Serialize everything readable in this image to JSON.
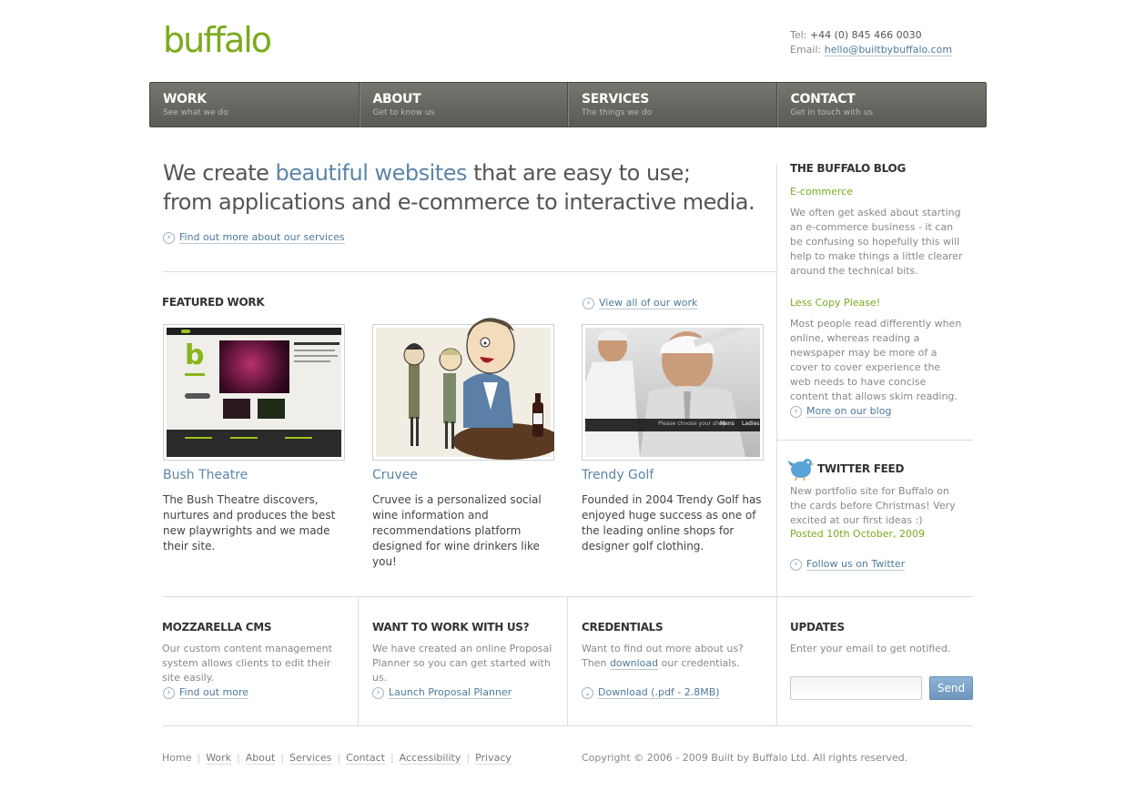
{
  "header": {
    "logo": "buffalo",
    "tel_label": "Tel:",
    "tel_value": "+44 (0) 845 466 0030",
    "email_label": "Email:",
    "email_value": "hello@builtbybuffalo.com"
  },
  "nav": [
    {
      "title": "WORK",
      "sub": "See what we do"
    },
    {
      "title": "ABOUT",
      "sub": "Get to know us"
    },
    {
      "title": "SERVICES",
      "sub": "The things we do"
    },
    {
      "title": "CONTACT",
      "sub": "Get in touch with us"
    }
  ],
  "hero": {
    "line1_pre": "We create ",
    "line1_highlight": "beautiful websites",
    "line1_post": " that are easy to use;",
    "line2": "from applications and e-commerce to interactive media.",
    "link": "Find out more about our services"
  },
  "featured": {
    "title": "FEATURED WORK",
    "view_all": "View all of our work",
    "projects": [
      {
        "title": "Bush Theatre",
        "desc": "The Bush Theatre discovers, nurtures and produces the best new playwrights and we made their site."
      },
      {
        "title": "Cruvee",
        "desc": "Cruvee is a personalized social wine information and recommendations platform designed for wine drinkers like you!"
      },
      {
        "title": "Trendy Golf",
        "desc": "Founded in 2004 Trendy Golf has enjoyed huge success as one of the leading online shops for designer golf clothing."
      }
    ],
    "thumb_text": {
      "bush_logo": "b",
      "golf_bar": "Please choose your shop",
      "golf_mens": "Mens",
      "golf_ladies": "Ladies"
    }
  },
  "blog": {
    "title": "THE BUFFALO BLOG",
    "posts": [
      {
        "title": "E-commerce",
        "text": "We often get asked about starting an e-commerce business - it can be confusing so hopefully this will help to make things a little clearer around the technical bits."
      },
      {
        "title": "Less Copy Please!",
        "text": "Most people read differently when online, whereas reading a newspaper may be more of a cover to cover experience the web needs to have concise content that allows skim reading."
      }
    ],
    "more": "More on our blog"
  },
  "twitter": {
    "title": "TWITTER FEED",
    "text": "New portfolio site for Buffalo on the cards before Christmas! Very excited at our first ideas :)",
    "posted": "Posted 10th October, 2009",
    "follow": "Follow us on Twitter"
  },
  "bottom": {
    "cms": {
      "title": "MOZZARELLA CMS",
      "text": "Our custom content management system allows clients to edit their site easily.",
      "link": "Find out more"
    },
    "work": {
      "title": "WANT TO WORK WITH US?",
      "text": "We have created an online Proposal Planner so you can get started with us.",
      "link": "Launch Proposal Planner"
    },
    "credentials": {
      "title": "CREDENTIALS",
      "text_pre": "Want to find out more about us? Then ",
      "text_link": "download",
      "text_post": " our credentials.",
      "link": "Download (.pdf - 2.8MB)"
    },
    "updates": {
      "title": "UPDATES",
      "text": "Enter your email to get notified.",
      "email_value": "",
      "send": "Send"
    }
  },
  "footer": {
    "links": [
      "Home",
      "Work",
      "About",
      "Services",
      "Contact",
      "Accessibility",
      "Privacy"
    ],
    "copyright": "Copyright © 2006 - 2009 Built by Buffalo Ltd. All rights reserved."
  }
}
